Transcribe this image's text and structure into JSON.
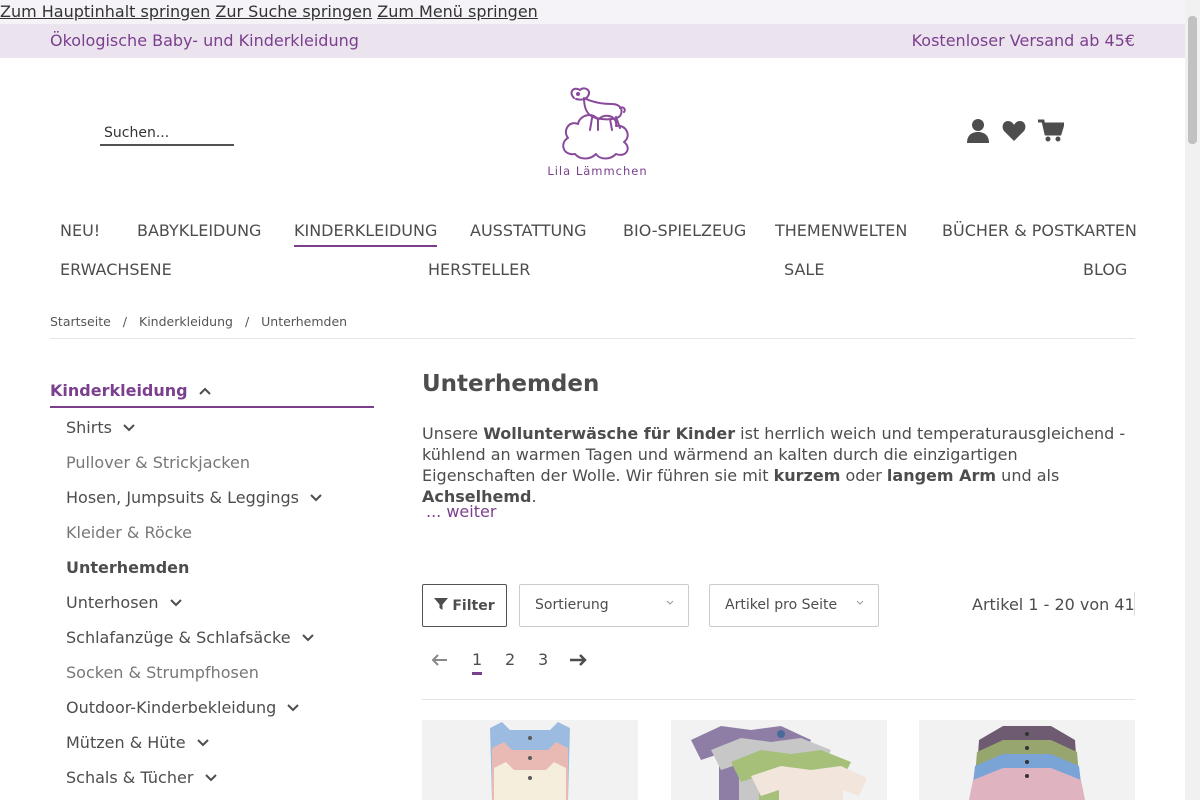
{
  "skip_links": [
    "Zum Hauptinhalt springen",
    "Zur Suche springen",
    "Zum Menü springen"
  ],
  "topbar": {
    "tagline": "Ökologische Baby- und Kinderkleidung",
    "shipping": "Kostenloser Versand ab 45€"
  },
  "search": {
    "placeholder": "Suchen..."
  },
  "logo": {
    "text": "Lila Lämmchen"
  },
  "header_icons": [
    "user-icon",
    "heart-icon",
    "cart-icon"
  ],
  "main_nav": [
    "NEU!",
    "BABYKLEIDUNG",
    "KINDERKLEIDUNG",
    "AUSSTATTUNG",
    "BIO-SPIELZEUG",
    "THEMENWELTEN",
    "BÜCHER & POSTKARTEN",
    "ERWACHSENE",
    "HERSTELLER",
    "SALE",
    "BLOG"
  ],
  "breadcrumb": [
    "Startseite",
    "Kinderkleidung",
    "Unterhemden"
  ],
  "breadcrumb_sep": "/",
  "sidebar": {
    "title": "Kinderkleidung",
    "items": [
      "Shirts",
      "Pullover & Strickjacken",
      "Hosen, Jumpsuits & Leggings",
      "Kleider & Röcke",
      "Unterhemden",
      "Unterhosen",
      "Schlafanzüge & Schlafsäcke",
      "Socken & Strumpfhosen",
      "Outdoor-Kinderbekleidung",
      "Mützen & Hüte",
      "Schals & Tücher"
    ]
  },
  "category": {
    "title": "Unterhemden",
    "intro": {
      "t1": "Unsere ",
      "b1": "Wollunterwäsche für Kinder",
      "t2": " ist herrlich weich und temperaturausgleichend - kühlend an warmen Tagen und wärmend an kalten durch die einzigartigen Eigenschaften der Wolle. Wir führen sie mit ",
      "b2": "kurzem",
      "t3": " oder ",
      "b3": "langem Arm",
      "t4": " und als ",
      "b4": "Achselhemd",
      "t5": "."
    },
    "more": "... weiter"
  },
  "toolbar": {
    "filter": "Filter",
    "sort": "Sortierung",
    "per_page": "Artikel pro Seite",
    "count": "Artikel 1 - 20 von 41"
  },
  "pagination": {
    "pages": [
      "1",
      "2",
      "3"
    ],
    "current": "1"
  },
  "colors": {
    "accent": "#7b3f8e",
    "topbar_bg": "#ebe4ee",
    "text": "#4d4d4d"
  }
}
